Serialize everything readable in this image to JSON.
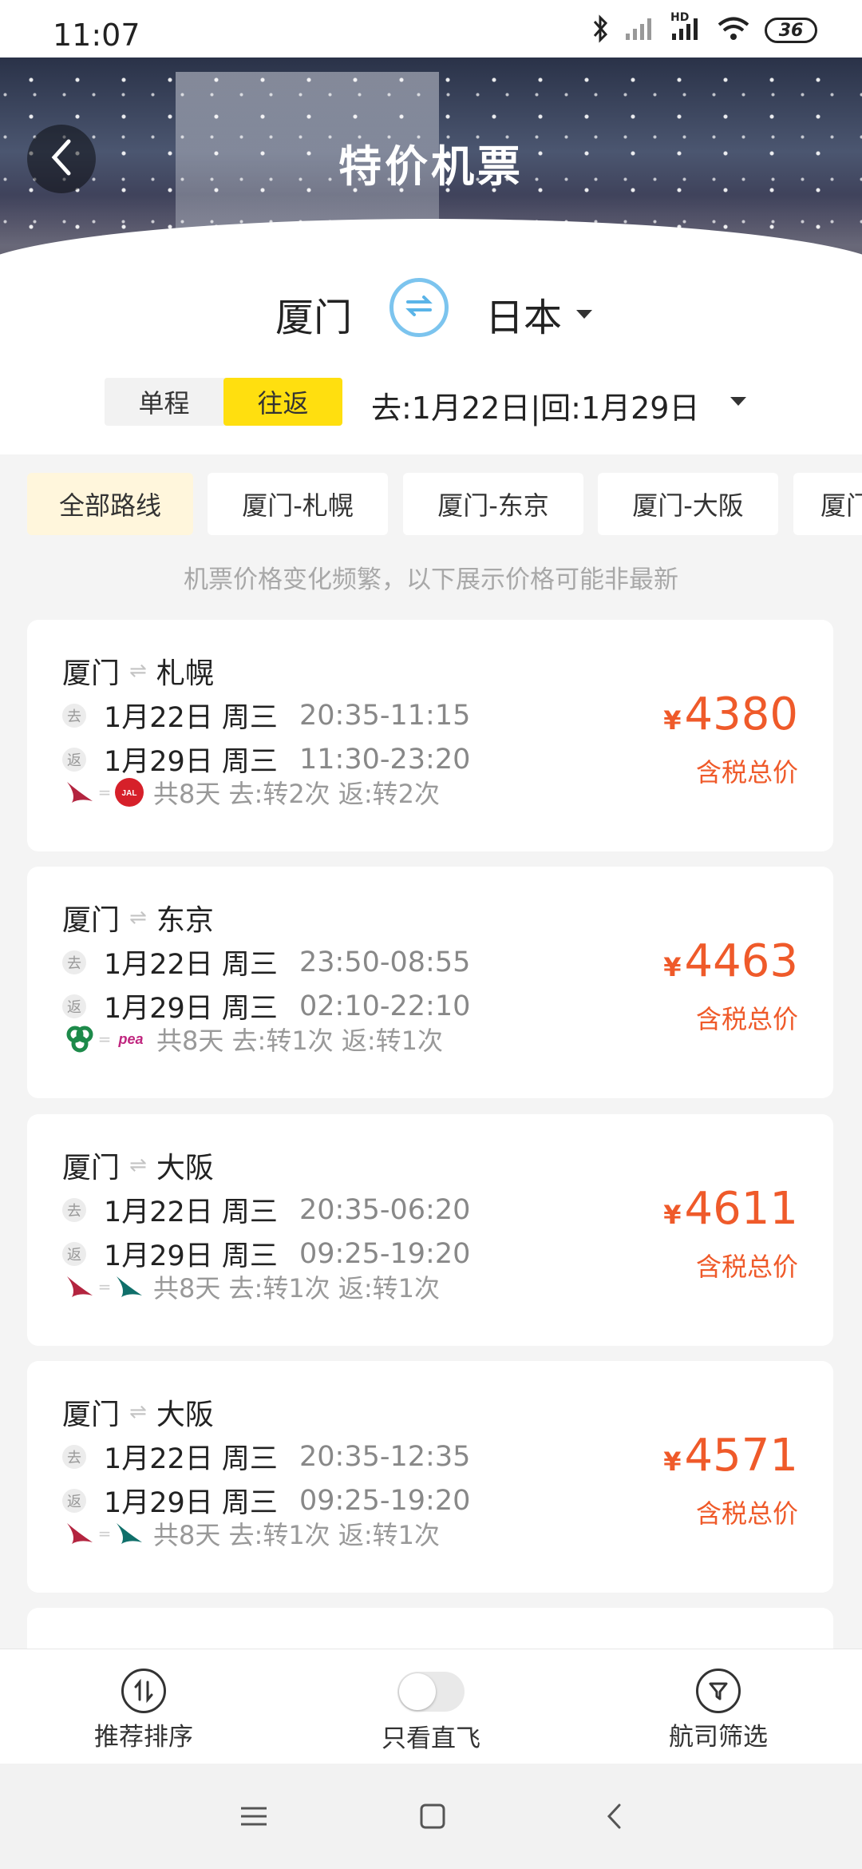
{
  "status_bar": {
    "time": "11:07",
    "network_label": "HD",
    "battery": "36"
  },
  "header": {
    "title": "特价机票"
  },
  "search": {
    "from_city": "厦门",
    "to_city": "日本",
    "trip_types": [
      "单程",
      "往返"
    ],
    "selected_trip": "往返",
    "date_range": "去:1月22日|回:1月29日"
  },
  "route_tabs": [
    "全部路线",
    "厦门-札幌",
    "厦门-东京",
    "厦门-大阪",
    "厦门"
  ],
  "notice": "机票价格变化频繁，以下展示价格可能非最新",
  "cards": [
    {
      "from": "厦门",
      "to": "札幌",
      "out_badge": "去",
      "out_date": "1月22日 周三",
      "out_time": "20:35-11:15",
      "ret_badge": "返",
      "ret_date": "1月29日 周三",
      "ret_time": "11:30-23:20",
      "airlines": [
        "cathay-pacific",
        "jal"
      ],
      "info": "共8天 去:转2次 返:转2次",
      "currency": "¥",
      "price": "4380",
      "price_label": "含税总价"
    },
    {
      "from": "厦门",
      "to": "东京",
      "out_badge": "去",
      "out_date": "1月22日 周三",
      "out_time": "23:50-08:55",
      "ret_badge": "返",
      "ret_date": "1月29日 周三",
      "ret_time": "02:10-22:10",
      "airlines": [
        "spring-airlines",
        "peach"
      ],
      "info": "共8天 去:转1次 返:转1次",
      "currency": "¥",
      "price": "4463",
      "price_label": "含税总价"
    },
    {
      "from": "厦门",
      "to": "大阪",
      "out_badge": "去",
      "out_date": "1月22日 周三",
      "out_time": "20:35-06:20",
      "ret_badge": "返",
      "ret_date": "1月29日 周三",
      "ret_time": "09:25-19:20",
      "airlines": [
        "cathay-pacific",
        "cathay-pacific-green"
      ],
      "info": "共8天 去:转1次 返:转1次",
      "currency": "¥",
      "price": "4611",
      "price_label": "含税总价"
    },
    {
      "from": "厦门",
      "to": "大阪",
      "out_badge": "去",
      "out_date": "1月22日 周三",
      "out_time": "20:35-12:35",
      "ret_badge": "返",
      "ret_date": "1月29日 周三",
      "ret_time": "09:25-19:20",
      "airlines": [
        "cathay-pacific",
        "cathay-pacific-green"
      ],
      "info": "共8天 去:转1次 返:转1次",
      "currency": "¥",
      "price": "4571",
      "price_label": "含税总价"
    }
  ],
  "bottom_bar": {
    "sort_label": "推荐排序",
    "direct_label": "只看直飞",
    "filter_label": "航司筛选"
  },
  "colors": {
    "accent_yellow": "#ffdf0f",
    "price_orange": "#ef5a2a",
    "swap_blue": "#7cc4ee"
  }
}
